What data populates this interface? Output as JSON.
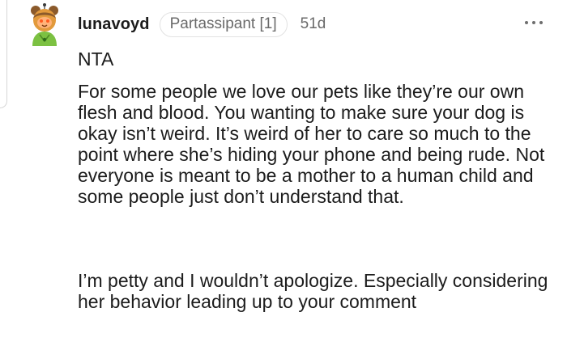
{
  "comment": {
    "username": "lunavoyd",
    "flair": "Partassipant [1]",
    "age": "51d",
    "paragraphs": [
      "NTA",
      "For some people we love our pets like they’re our own flesh and blood. You wanting to make sure your dog is okay isn’t weird. It’s weird of her to care so much to the point where she’s hiding your phone and being rude. Not everyone is meant to be a mother to a human child and some people just don’t understand that.",
      "I’m petty and I wouldn’t apologize. Especially considering her behavior leading up to your comment"
    ]
  },
  "icons": {
    "avatar": "avatar-icon",
    "more": "more-options-icon"
  },
  "colors": {
    "text": "#1c1c1c",
    "muted": "#6a6a6a",
    "flair_border": "#e2e2e2",
    "thread_line": "#d7d7d7",
    "avatar_skin": "#e29a3c",
    "avatar_shirt": "#7cc142",
    "avatar_face": "#ffb37a"
  }
}
